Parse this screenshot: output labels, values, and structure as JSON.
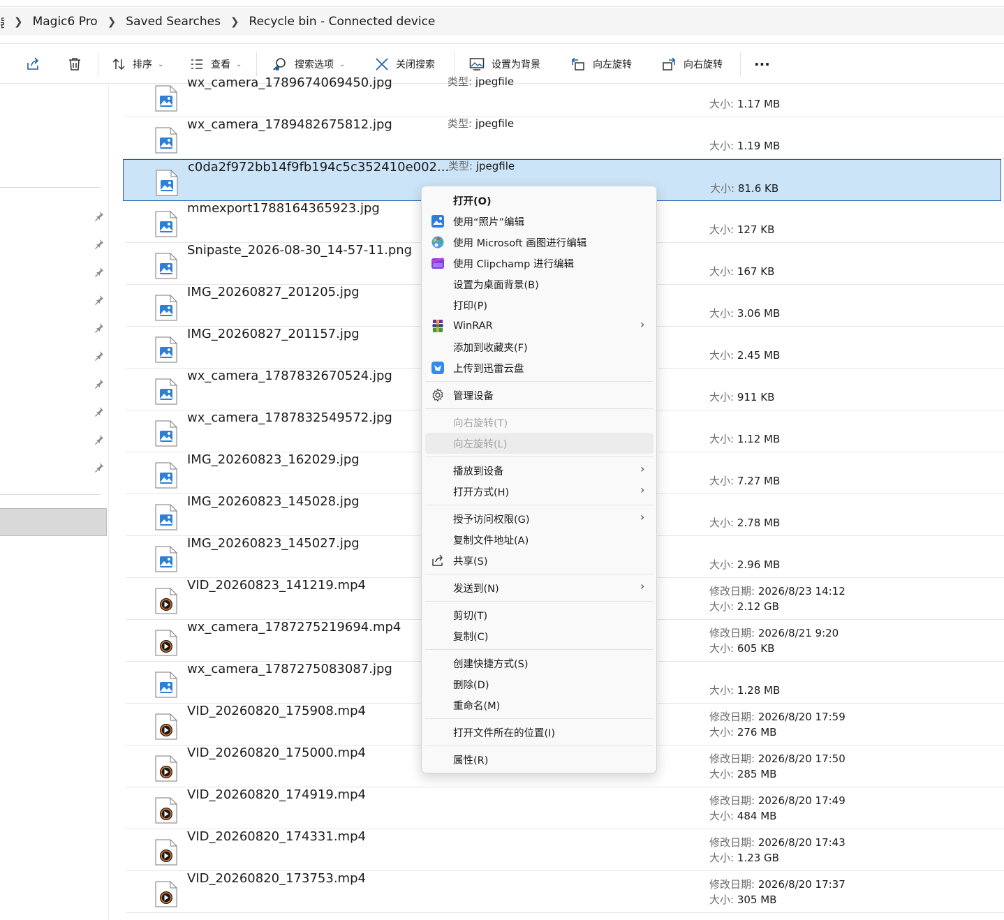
{
  "breadcrumb": {
    "lead": "器",
    "items": [
      "Magic6 Pro",
      "Saved Searches",
      "Recycle bin - Connected device"
    ]
  },
  "toolbar": {
    "sort_label": "排序",
    "view_label": "查看",
    "search_options_label": "搜索选项",
    "close_search_label": "关闭搜索",
    "set_background_label": "设置为背景",
    "rotate_left_label": "向左旋转",
    "rotate_right_label": "向右旋转",
    "more_label": "···"
  },
  "labels": {
    "type": "类型:",
    "size": "大小:",
    "modified": "修改日期:"
  },
  "files": [
    {
      "name": "wx_camera_1789674069450.jpg",
      "type": "jpegfile",
      "size": "1.17 MB",
      "date": "",
      "kind": "image"
    },
    {
      "name": "wx_camera_1789482675812.jpg",
      "type": "jpegfile",
      "size": "1.19 MB",
      "date": "",
      "kind": "image"
    },
    {
      "name": "c0da2f972bb14f9fb194c5c352410e002...",
      "type": "jpegfile",
      "size": "81.6 KB",
      "date": "",
      "kind": "image",
      "selected": true
    },
    {
      "name": "mmexport1788164365923.jpg",
      "type": "",
      "size": "127 KB",
      "date": "",
      "kind": "image"
    },
    {
      "name": "Snipaste_2026-08-30_14-57-11.png",
      "type": "",
      "size": "167 KB",
      "date": "",
      "kind": "image"
    },
    {
      "name": "IMG_20260827_201205.jpg",
      "type": "",
      "size": "3.06 MB",
      "date": "",
      "kind": "image"
    },
    {
      "name": "IMG_20260827_201157.jpg",
      "type": "",
      "size": "2.45 MB",
      "date": "",
      "kind": "image"
    },
    {
      "name": "wx_camera_1787832670524.jpg",
      "type": "",
      "size": "911 KB",
      "date": "",
      "kind": "image"
    },
    {
      "name": "wx_camera_1787832549572.jpg",
      "type": "",
      "size": "1.12 MB",
      "date": "",
      "kind": "image"
    },
    {
      "name": "IMG_20260823_162029.jpg",
      "type": "",
      "size": "7.27 MB",
      "date": "",
      "kind": "image"
    },
    {
      "name": "IMG_20260823_145028.jpg",
      "type": "",
      "size": "2.78 MB",
      "date": "",
      "kind": "image"
    },
    {
      "name": "IMG_20260823_145027.jpg",
      "type": "",
      "size": "2.96 MB",
      "date": "",
      "kind": "image"
    },
    {
      "name": "VID_20260823_141219.mp4",
      "type": "",
      "size": "2.12 GB",
      "date": "2026/8/23 14:12",
      "kind": "video"
    },
    {
      "name": "wx_camera_1787275219694.mp4",
      "type": "",
      "size": "605 KB",
      "date": "2026/8/21 9:20",
      "kind": "video"
    },
    {
      "name": "wx_camera_1787275083087.jpg",
      "type": "",
      "size": "1.28 MB",
      "date": "",
      "kind": "image"
    },
    {
      "name": "VID_20260820_175908.mp4",
      "type": "",
      "size": "276 MB",
      "date": "2026/8/20 17:59",
      "kind": "video"
    },
    {
      "name": "VID_20260820_175000.mp4",
      "type": "",
      "size": "285 MB",
      "date": "2026/8/20 17:50",
      "kind": "video"
    },
    {
      "name": "VID_20260820_174919.mp4",
      "type": "",
      "size": "484 MB",
      "date": "2026/8/20 17:49",
      "kind": "video"
    },
    {
      "name": "VID_20260820_174331.mp4",
      "type": "",
      "size": "1.23 GB",
      "date": "2026/8/20 17:43",
      "kind": "video"
    },
    {
      "name": "VID_20260820_173753.mp4",
      "type": "",
      "size": "305 MB",
      "date": "2026/8/20 17:37",
      "kind": "video"
    }
  ],
  "context_menu": [
    {
      "label": "打开(O)",
      "icon": "",
      "bold": true
    },
    {
      "label": "使用“照片”编辑",
      "icon": "photos-icon"
    },
    {
      "label": "使用 Microsoft 画图进行编辑",
      "icon": "paint-icon"
    },
    {
      "label": "使用 Clipchamp 进行编辑",
      "icon": "clipchamp-icon"
    },
    {
      "label": "设置为桌面背景(B)",
      "icon": ""
    },
    {
      "label": "打印(P)",
      "icon": ""
    },
    {
      "label": "WinRAR",
      "icon": "winrar-icon",
      "submenu": true
    },
    {
      "label": "添加到收藏夹(F)",
      "icon": ""
    },
    {
      "label": "上传到迅雷云盘",
      "icon": "xunlei-icon"
    },
    {
      "label": "管理设备",
      "icon": "gear-icon"
    },
    {
      "label": "向右旋转(T)",
      "icon": "",
      "disabled": true
    },
    {
      "label": "向左旋转(L)",
      "icon": "",
      "disabled": true,
      "hover": true
    },
    {
      "label": "播放到设备",
      "icon": "",
      "submenu": true
    },
    {
      "label": "打开方式(H)",
      "icon": "",
      "submenu": true
    },
    {
      "label": "授予访问权限(G)",
      "icon": "",
      "submenu": true
    },
    {
      "label": "复制文件地址(A)",
      "icon": ""
    },
    {
      "label": "共享(S)",
      "icon": "share-icon"
    },
    {
      "label": "发送到(N)",
      "icon": "",
      "submenu": true
    },
    {
      "label": "剪切(T)",
      "icon": ""
    },
    {
      "label": "复制(C)",
      "icon": ""
    },
    {
      "label": "创建快捷方式(S)",
      "icon": ""
    },
    {
      "label": "删除(D)",
      "icon": ""
    },
    {
      "label": "重命名(M)",
      "icon": ""
    },
    {
      "label": "打开文件所在的位置(I)",
      "icon": ""
    },
    {
      "label": "属性(R)",
      "icon": ""
    }
  ],
  "colors": {
    "selection_bg": "#cce4f7",
    "selection_border": "#1f5fa8",
    "accent": "#0067c0"
  }
}
